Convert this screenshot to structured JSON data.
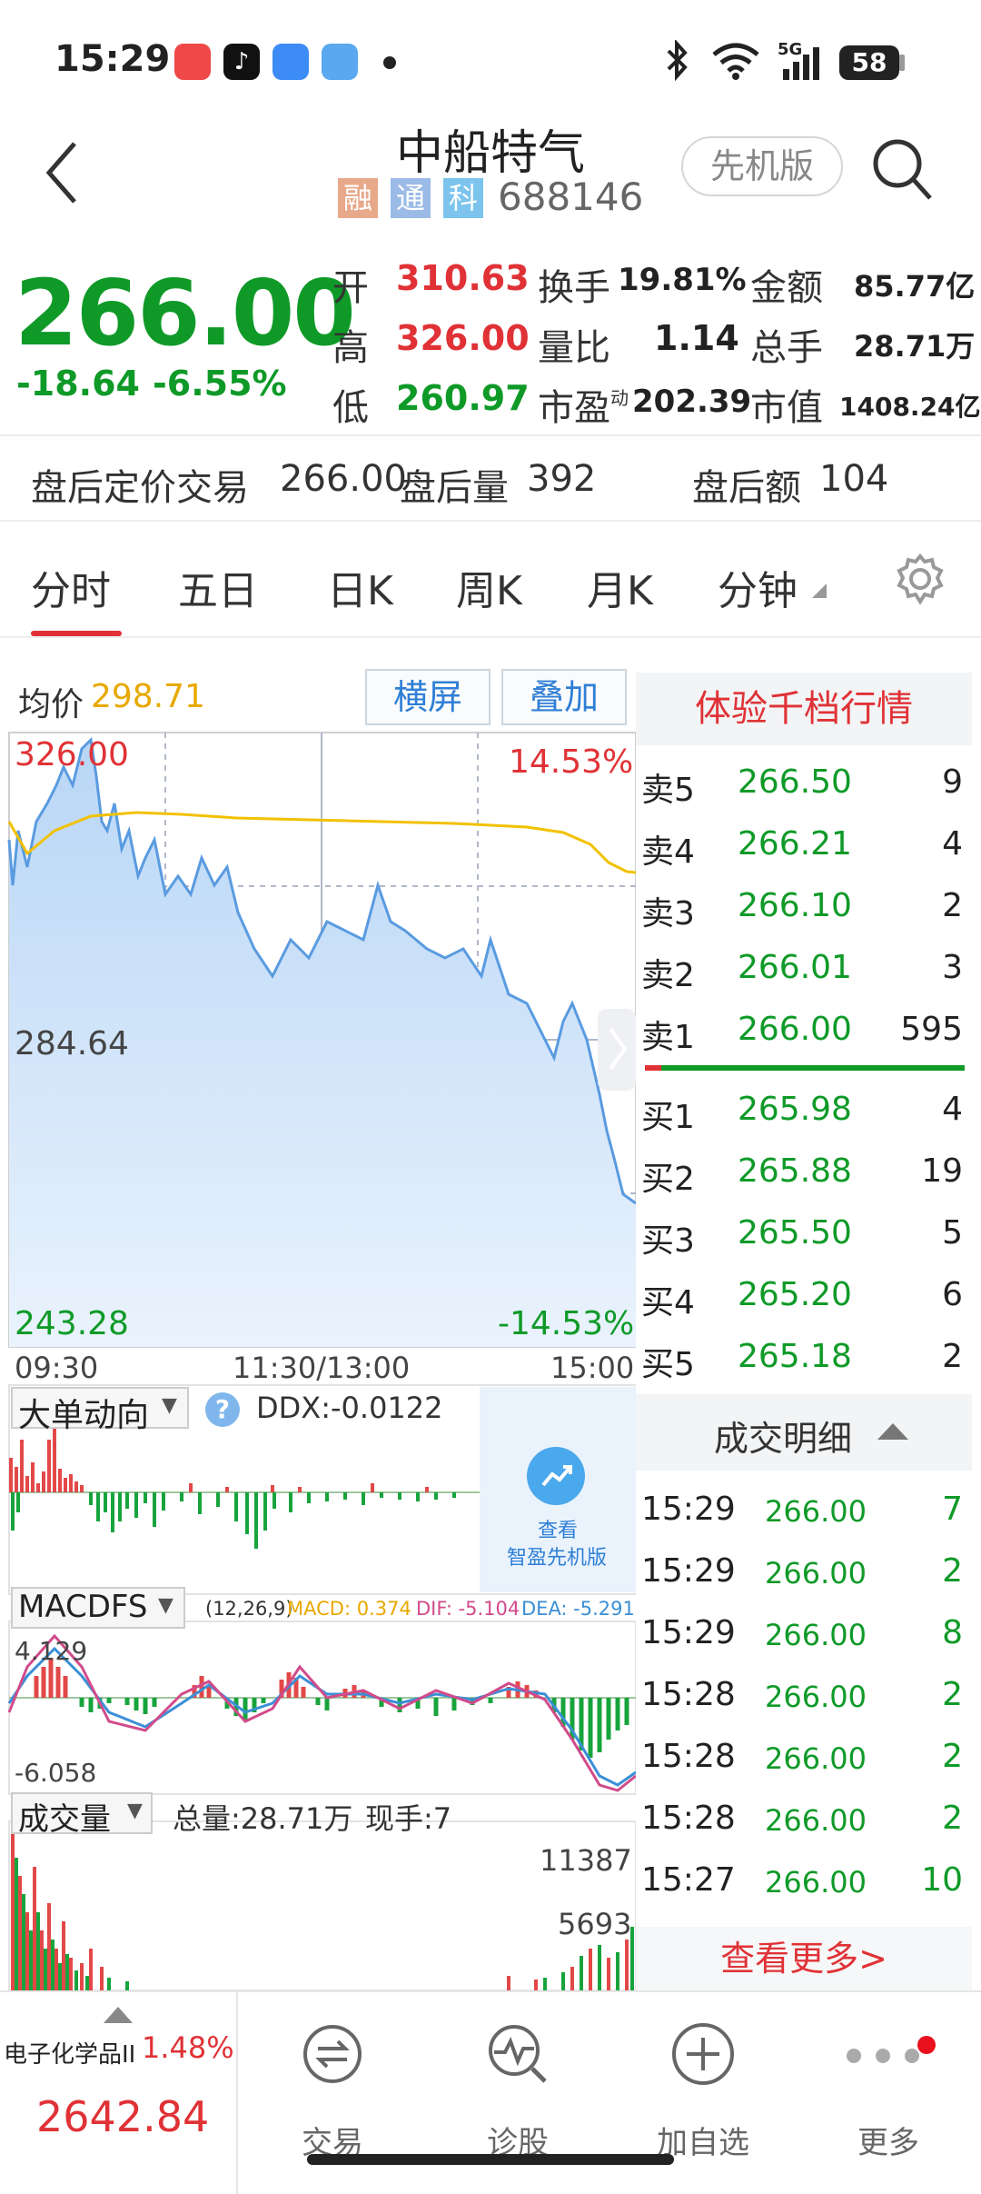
{
  "status_bar": {
    "time": "15:29",
    "battery": "58",
    "network": "5G"
  },
  "header": {
    "title": "中船特气",
    "tags": [
      "融",
      "通",
      "科"
    ],
    "code": "688146",
    "mode_button": "先机版"
  },
  "quote": {
    "price": "266.00",
    "change": "-18.64",
    "change_pct": "-6.55%",
    "open_label": "开",
    "open": "310.63",
    "high_label": "高",
    "high": "326.00",
    "low_label": "低",
    "low": "260.97",
    "turnover_label": "换手",
    "turnover": "19.81%",
    "vol_ratio_label": "量比",
    "vol_ratio": "1.14",
    "pe_label": "市盈",
    "pe_sup": "动",
    "pe": "202.39",
    "amount_label": "金额",
    "amount": "85.77亿",
    "total_hands_label": "总手",
    "total_hands": "28.71万",
    "mkt_cap_label": "市值",
    "mkt_cap": "1408.24亿"
  },
  "after_hours": {
    "label": "盘后定价交易",
    "price": "266.00",
    "volume_label": "盘后量",
    "volume": "392",
    "amount_label": "盘后额",
    "amount": "104"
  },
  "tabs": [
    "分时",
    "五日",
    "日K",
    "周K",
    "月K",
    "分钟"
  ],
  "chart": {
    "avg_label": "均价",
    "avg_value": "298.71",
    "landscape_btn": "横屏",
    "overlay_btn": "叠加",
    "top_price": "326.00",
    "mid_price": "284.64",
    "bottom_price": "243.28",
    "top_pct": "14.53%",
    "bottom_pct": "-14.53%",
    "time_start": "09:30",
    "time_mid": "11:30/13:00",
    "time_end": "15:00"
  },
  "ddx": {
    "label": "大单动向",
    "value": "DDX:-0.0122",
    "promo_line1": "查看",
    "promo_line2": "智盈先机版"
  },
  "macd": {
    "label": "MACDFS",
    "params": "(12,26,9)",
    "macd": "MACD: 0.374",
    "dif": "DIF: -5.104",
    "dea": "DEA: -5.291",
    "max": "4.129",
    "min": "-6.058"
  },
  "volume": {
    "label": "成交量",
    "total": "总量:28.71万",
    "current": "现手:7",
    "max": "11387",
    "mid": "5693"
  },
  "orderbook": {
    "title": "体验千档行情",
    "sells": [
      {
        "label": "卖5",
        "price": "266.50",
        "qty": "9"
      },
      {
        "label": "卖4",
        "price": "266.21",
        "qty": "4"
      },
      {
        "label": "卖3",
        "price": "266.10",
        "qty": "2"
      },
      {
        "label": "卖2",
        "price": "266.01",
        "qty": "3"
      },
      {
        "label": "卖1",
        "price": "266.00",
        "qty": "595"
      }
    ],
    "buys": [
      {
        "label": "买1",
        "price": "265.98",
        "qty": "4"
      },
      {
        "label": "买2",
        "price": "265.88",
        "qty": "19"
      },
      {
        "label": "买3",
        "price": "265.50",
        "qty": "5"
      },
      {
        "label": "买4",
        "price": "265.20",
        "qty": "6"
      },
      {
        "label": "买5",
        "price": "265.18",
        "qty": "2"
      }
    ],
    "trades_title": "成交明细",
    "trades": [
      {
        "time": "15:29",
        "price": "266.00",
        "qty": "7"
      },
      {
        "time": "15:29",
        "price": "266.00",
        "qty": "2"
      },
      {
        "time": "15:29",
        "price": "266.00",
        "qty": "8"
      },
      {
        "time": "15:28",
        "price": "266.00",
        "qty": "2"
      },
      {
        "time": "15:28",
        "price": "266.00",
        "qty": "2"
      },
      {
        "time": "15:28",
        "price": "266.00",
        "qty": "2"
      },
      {
        "time": "15:27",
        "price": "266.00",
        "qty": "10"
      }
    ],
    "more": "查看更多>"
  },
  "bottom": {
    "sector": "电子化学品II",
    "sector_pct": "1.48%",
    "sector_index": "2642.84",
    "nav": [
      "交易",
      "诊股",
      "加自选",
      "更多"
    ]
  }
}
